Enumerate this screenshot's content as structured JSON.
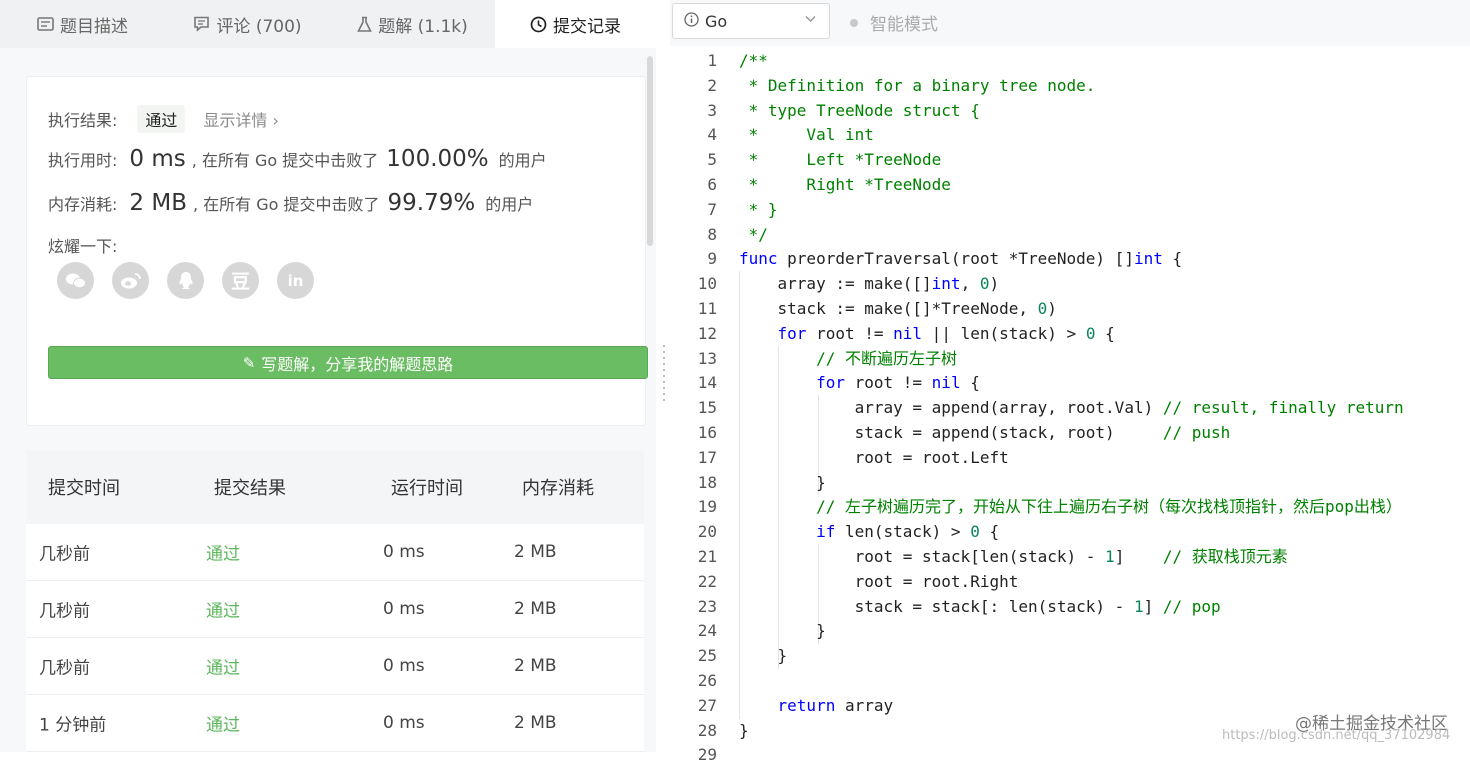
{
  "tabs": [
    {
      "label": "题目描述",
      "icon": "description-icon"
    },
    {
      "label": "评论 (700)",
      "icon": "comment-icon"
    },
    {
      "label": "题解 (1.1k)",
      "icon": "flask-icon"
    },
    {
      "label": "提交记录",
      "icon": "clock-icon"
    }
  ],
  "result": {
    "status_label": "执行结果:",
    "status_value": "通过",
    "detail_link": "显示详情",
    "time_label": "执行用时:",
    "time_value": "0 ms",
    "time_text": ", 在所有 Go 提交中击败了",
    "time_pct": "100.00%",
    "mem_label": "内存消耗:",
    "mem_value": "2 MB",
    "mem_text": ", 在所有 Go 提交中击败了",
    "mem_pct": "99.79%",
    "users_suffix": "的用户",
    "share_label": "炫耀一下:"
  },
  "write_button": "写题解，分享我的解题思路",
  "table": {
    "headers": [
      "提交时间",
      "提交结果",
      "运行时间",
      "内存消耗"
    ],
    "rows": [
      [
        "几秒前",
        "通过",
        "0 ms",
        "2 MB"
      ],
      [
        "几秒前",
        "通过",
        "0 ms",
        "2 MB"
      ],
      [
        "几秒前",
        "通过",
        "0 ms",
        "2 MB"
      ],
      [
        "1 分钟前",
        "通过",
        "0 ms",
        "2 MB"
      ]
    ]
  },
  "editor": {
    "language": "Go",
    "smart_mode": "智能模式",
    "lines": [
      "/**",
      " * Definition for a binary tree node.",
      " * type TreeNode struct {",
      " *     Val int",
      " *     Left *TreeNode",
      " *     Right *TreeNode",
      " * }",
      " */",
      "func preorderTraversal(root *TreeNode) []int {",
      "    array := make([]int, 0)",
      "    stack := make([]*TreeNode, 0)",
      "    for root != nil || len(stack) > 0 {",
      "        // 不断遍历左子树",
      "        for root != nil {",
      "            array = append(array, root.Val) // result, finally return",
      "            stack = append(stack, root)     // push",
      "            root = root.Left",
      "        }",
      "        // 左子树遍历完了，开始从下往上遍历右子树（每次找栈顶指针，然后pop出栈）",
      "        if len(stack) > 0 {",
      "            root = stack[len(stack) - 1]    // 获取栈顶元素",
      "            root = root.Right",
      "            stack = stack[: len(stack) - 1] // pop",
      "        }",
      "    }",
      "",
      "    return array",
      "}",
      ""
    ],
    "line_numbers": [
      "1",
      "2",
      "3",
      "4",
      "5",
      "6",
      "7",
      "8",
      "9",
      "10",
      "11",
      "12",
      "13",
      "14",
      "15",
      "16",
      "17",
      "18",
      "19",
      "20",
      "21",
      "22",
      "23",
      "24",
      "25",
      "26",
      "27",
      "28",
      "29"
    ]
  },
  "watermark": "@稀土掘金技术社区",
  "watermark_url": "https://blog.csdn.net/qq_37102984",
  "colors": {
    "accent_green": "#5cb85c",
    "button_green": "#6abd62",
    "keyword_blue": "#0000ff",
    "comment_green": "#008000",
    "number_green": "#098658"
  }
}
